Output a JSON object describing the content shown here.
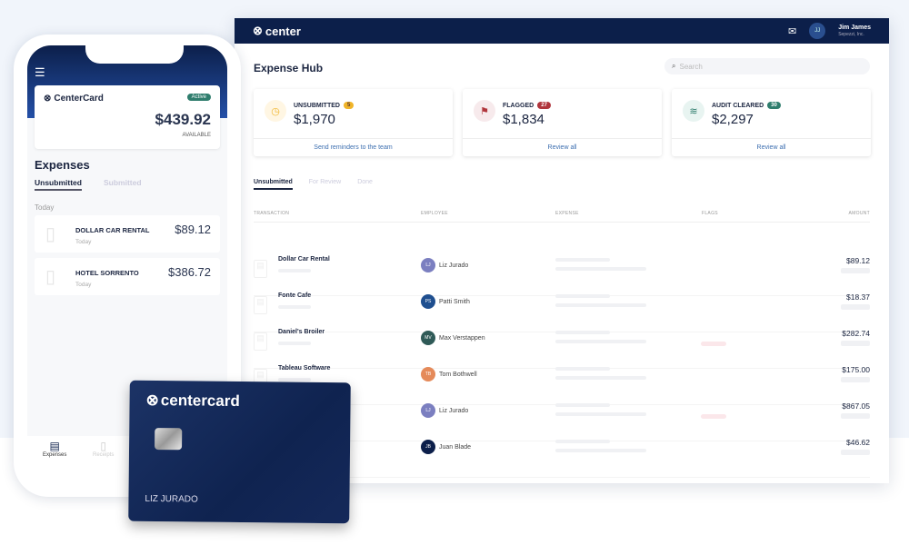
{
  "desktop": {
    "brand": "center",
    "user": {
      "initials": "JJ",
      "name": "Jim James",
      "org": "Sepezzi, Inc."
    },
    "title": "Expense Hub",
    "search_placeholder": "Search",
    "summary": [
      {
        "label": "UNSUBMITTED",
        "count": "5",
        "value": "$1,970",
        "action": "Send reminders to the team",
        "color": "#f0b429",
        "icon": "clock-icon"
      },
      {
        "label": "FLAGGED",
        "count": "27",
        "value": "$1,834",
        "action": "Review all",
        "color": "#b0353c",
        "icon": "flag-icon"
      },
      {
        "label": "AUDIT CLEARED",
        "count": "30",
        "value": "$2,297",
        "action": "Review all",
        "color": "#2f7d6d",
        "icon": "layers-icon"
      }
    ],
    "tabs": [
      "Unsubmitted",
      "For Review",
      "Done"
    ],
    "columns": [
      "TRANSACTION",
      "EMPLOYEE",
      "EXPENSE",
      "FLAGS",
      "AMOUNT"
    ],
    "rows": [
      {
        "name": "Dollar Car Rental",
        "initials": "LJ",
        "employee": "Liz Jurado",
        "amount": "$89.12",
        "color": "#7b7fc0",
        "flag": false
      },
      {
        "name": "Fonte Cafe",
        "initials": "PS",
        "employee": "Patti Smith",
        "amount": "$18.37",
        "color": "#1f4f8f",
        "flag": false
      },
      {
        "name": "Daniel's Broiler",
        "initials": "MV",
        "employee": "Max Verstappen",
        "amount": "$282.74",
        "color": "#2f5a57",
        "flag": true
      },
      {
        "name": "Tableau Software",
        "initials": "TB",
        "employee": "Tom Bothwell",
        "amount": "$175.00",
        "color": "#e58a5a",
        "flag": false
      },
      {
        "name": "",
        "initials": "LJ",
        "employee": "Liz Jurado",
        "amount": "$867.05",
        "color": "#7b7fc0",
        "flag": true
      },
      {
        "name": "",
        "initials": "JB",
        "employee": "Juan Blade",
        "amount": "$46.62",
        "color": "#0c1f4a",
        "flag": false
      }
    ]
  },
  "phone": {
    "brand": "CenterCard",
    "status": "Active",
    "balance": "$439.92",
    "balance_label": "AVAILABLE",
    "section": "Expenses",
    "tabs": [
      "Unsubmitted",
      "Submitted"
    ],
    "group": "Today",
    "items": [
      {
        "name": "DOLLAR CAR RENTAL",
        "date": "Today",
        "amount": "$89.12"
      },
      {
        "name": "HOTEL SORRENTO",
        "date": "Today",
        "amount": "$386.72"
      }
    ],
    "nav": [
      "Expenses",
      "Receipts"
    ]
  },
  "card": {
    "brand": "centercard",
    "holder": "LIZ JURADO"
  }
}
